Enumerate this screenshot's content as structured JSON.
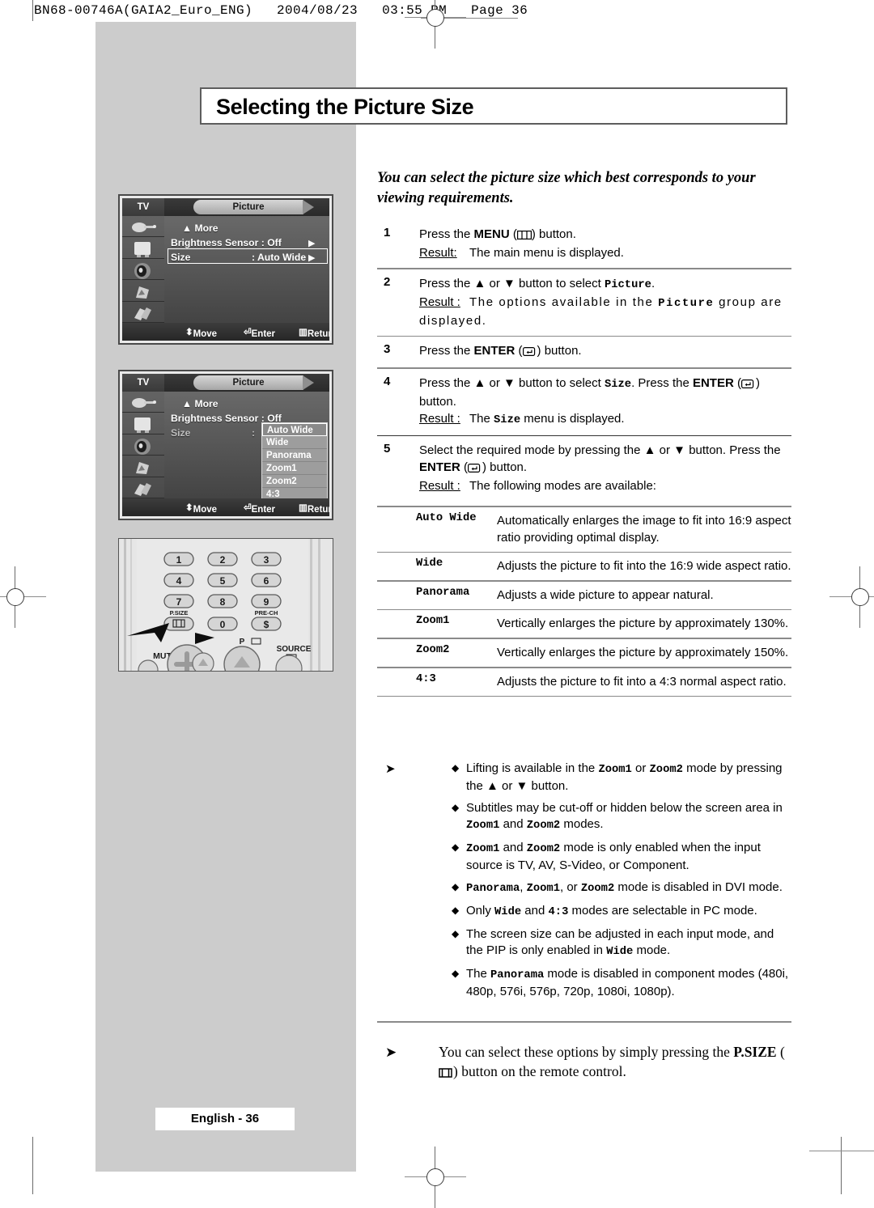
{
  "print_header": "BN68-00746A(GAIA2_Euro_ENG)   2004/08/23   03:55 PM   Page 36",
  "title": "Selecting the Picture Size",
  "intro": "You can select the picture size which best corresponds to your viewing requirements.",
  "osd1": {
    "tv_label": "TV",
    "tab_label": "Picture",
    "more": "More",
    "brightness_sensor": "Brightness Sensor : Off",
    "size_label": "Size",
    "size_value": ": Auto Wide",
    "footer_move": "Move",
    "footer_enter": "Enter",
    "footer_return": "Return"
  },
  "osd2": {
    "tv_label": "TV",
    "tab_label": "Picture",
    "more": "More",
    "brightness_sensor": "Brightness Sensor : Off",
    "size_label": "Size",
    "size_colon": ":",
    "options": [
      "Auto Wide",
      "Wide",
      "Panorama",
      "Zoom1",
      "Zoom2",
      "4:3"
    ],
    "selected_option": "Auto Wide",
    "footer_move": "Move",
    "footer_enter": "Enter",
    "footer_return": "Return"
  },
  "remote": {
    "keys": [
      "1",
      "2",
      "3",
      "4",
      "5",
      "6",
      "7",
      "8",
      "9",
      "0"
    ],
    "psize_label": "P.SIZE",
    "prech_label": "PRE-CH",
    "mute_label": "MUTE",
    "source_label": "SOURCE",
    "p_label": "P"
  },
  "steps": [
    {
      "num": "1",
      "body_pre": "Press the ",
      "body_bold": "MENU",
      "body_post": " ( ) button.",
      "result_label": "Result:",
      "result_text": "The main menu is displayed."
    },
    {
      "num": "2",
      "body_pre": "Press the ▲ or ▼ button to select ",
      "body_mono": "Picture",
      "body_post": ".",
      "result_label": "Result :",
      "result_pre": "The options available in the ",
      "result_mono": "Picture",
      "result_post": " group are displayed."
    },
    {
      "num": "3",
      "body_pre": "Press the ",
      "body_bold": "ENTER",
      "body_post": " ( ) button."
    },
    {
      "num": "4",
      "body_pre": "Press the ▲ or ▼ button to select ",
      "body_mono": "Size",
      "body_mid": ". Press the ",
      "body_bold": "ENTER",
      "body_post": " ( ) button.",
      "result_label": "Result :",
      "result_pre": "The ",
      "result_mono": "Size",
      "result_post": " menu is displayed."
    },
    {
      "num": "5",
      "body_pre": "Select the required  mode by pressing the ▲ or ▼ button. Press the ",
      "body_bold": "ENTER",
      "body_post": " ( ) button.",
      "result_label": "Result :",
      "result_text": "The following modes are available:"
    }
  ],
  "modes": [
    {
      "name": "Auto Wide",
      "desc": "Automatically enlarges the image to fit into 16:9 aspect ratio providing optimal display."
    },
    {
      "name": "Wide",
      "desc": "Adjusts the picture to fit into the 16:9 wide aspect ratio."
    },
    {
      "name": "Panorama",
      "desc": "Adjusts a wide picture to appear natural."
    },
    {
      "name": "Zoom1",
      "desc": "Vertically enlarges the picture by approximately 130%."
    },
    {
      "name": "Zoom2",
      "desc": "Vertically enlarges the picture by approximately 150%."
    },
    {
      "name": "4:3",
      "desc": "Adjusts the picture to fit into a 4:3 normal aspect ratio."
    }
  ],
  "notes": [
    {
      "has_arrow": true,
      "html": "Lifting is available in the <span class=\"mono\">Zoom1</span> or <span class=\"mono\">Zoom2</span> mode by pressing the ▲ or ▼ button."
    },
    {
      "has_arrow": false,
      "html": "Subtitles may be cut-off or hidden below the screen area in <span class=\"mono\">Zoom1</span> and <span class=\"mono\">Zoom2</span> modes."
    },
    {
      "has_arrow": false,
      "html": "<span class=\"mono\">Zoom1</span> and <span class=\"mono\">Zoom2</span> mode is only enabled when the input source is TV, AV, S-Video, or Component."
    },
    {
      "has_arrow": false,
      "html": "<span class=\"mono\">Panorama</span>, <span class=\"mono\">Zoom1</span>, or <span class=\"mono\">Zoom2</span> mode is disabled in DVI mode."
    },
    {
      "has_arrow": false,
      "html": "Only <span class=\"mono\">Wide</span> and <span class=\"mono\">4:3</span> modes are selectable in PC mode."
    },
    {
      "has_arrow": false,
      "html": "The screen size can be adjusted in each input mode, and the PIP is only enabled in <span class=\"mono\">Wide</span> mode."
    },
    {
      "has_arrow": false,
      "html": "The <span class=\"mono\">Panorama</span> mode is disabled in component modes (480i, 480p, 576i, 576p, 720p, 1080i, 1080p)."
    }
  ],
  "final_note": {
    "pre": "You can select these options by simply pressing the ",
    "bold": "P.SIZE",
    "post": " ( ) button on the remote control."
  },
  "footer": "English - 36",
  "colors": {
    "panel_gray": "#cccccc",
    "rule_gray": "#8a8a8a",
    "osd_dark": "#4a4a4a",
    "text": "#000000"
  }
}
